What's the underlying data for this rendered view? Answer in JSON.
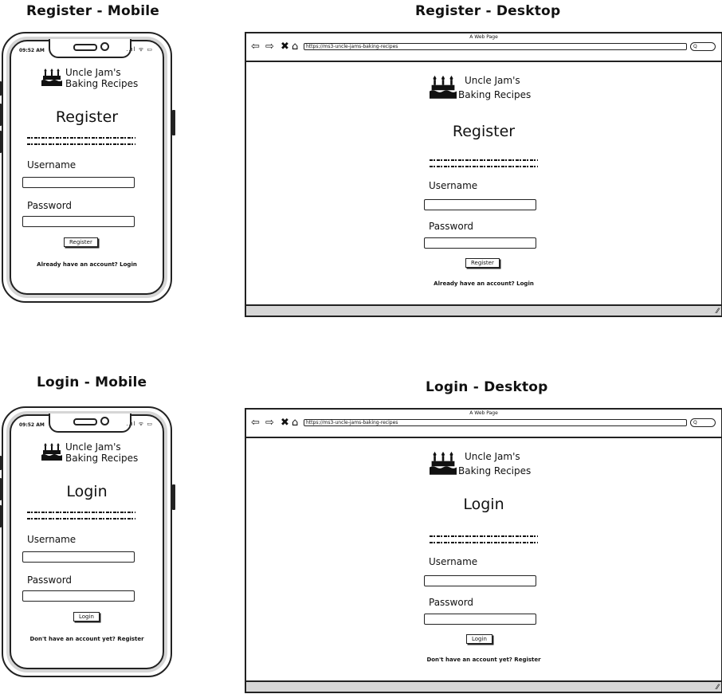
{
  "titles": {
    "register_mobile": "Register - Mobile",
    "register_desktop": "Register - Desktop",
    "login_mobile": "Login - Mobile",
    "login_desktop": "Login - Desktop"
  },
  "phone": {
    "time": "09:52 AM",
    "status_icons": "..ıl ᯤ ▭"
  },
  "browser": {
    "window_title": "A Web Page",
    "url": "https://ms3-uncle-jams-baking-recipes",
    "search_glyph": "Q"
  },
  "brand": {
    "line1": "Uncle Jam's",
    "line2": "Baking Recipes"
  },
  "form": {
    "username_label": "Username",
    "password_label": "Password"
  },
  "register": {
    "heading": "Register",
    "button": "Register",
    "footer": "Already have an account? Login"
  },
  "login": {
    "heading": "Login",
    "button": "Login",
    "footer": "Don't have an account yet? Register"
  }
}
